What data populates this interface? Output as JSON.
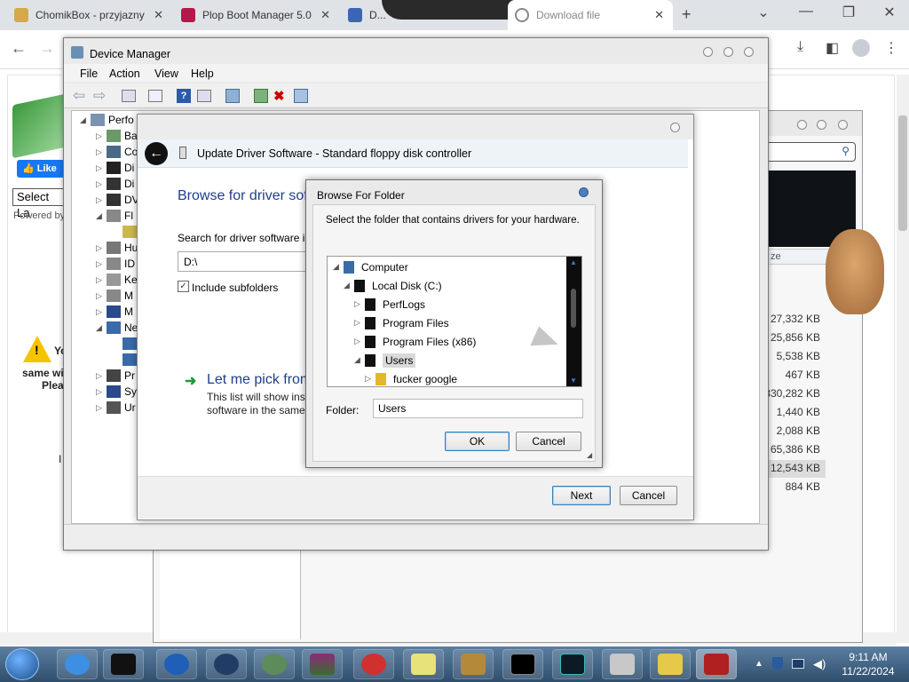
{
  "browser": {
    "tabs": [
      {
        "label": "ChomikBox - przyjazny"
      },
      {
        "label": "Plop Boot Manager 5.0"
      },
      {
        "label": "D..."
      },
      {
        "label": "Download file"
      }
    ],
    "new_tab": "+"
  },
  "webpage": {
    "like_label": "Like",
    "select_label": "Select La",
    "powered_by": "Powered by",
    "warn_text_1": "Yo",
    "warn_text_2": "same wi",
    "warn_text_3": "Plea",
    "letter_l": "I"
  },
  "filewin": {
    "col_header": "ze",
    "sizes": [
      "27,332 KB",
      "25,856 KB",
      "5,538 KB",
      "467 KB",
      "830,282 KB",
      "1,440 KB",
      "2,088 KB",
      "65,386 KB",
      "12,543 KB",
      "884 KB"
    ]
  },
  "devmgr": {
    "title": "Device Manager",
    "menu": [
      "File",
      "Action",
      "View",
      "Help"
    ],
    "tree": {
      "root": "Perfo",
      "items": [
        "Ba",
        "Co",
        "Di",
        "Di",
        "DV",
        "Fl",
        "",
        "Hu",
        "ID",
        "Ke",
        "M",
        "M",
        "Ne",
        "",
        "",
        "Pr",
        "Sy",
        "Ur"
      ]
    }
  },
  "update_driver": {
    "title": "Update Driver Software - Standard floppy disk controller",
    "heading": "Browse for driver sof",
    "search_label": "Search for driver software in",
    "path_value": "D:\\",
    "include_subfolders": "Include subfolders",
    "pick_heading": "Let me pick from",
    "pick_desc_1": "This list will show inst",
    "pick_desc_2": "software in the same",
    "next": "Next",
    "cancel": "Cancel"
  },
  "browse_folder": {
    "title": "Browse For Folder",
    "instruction": "Select the folder that contains drivers for your hardware.",
    "tree": [
      {
        "label": "Computer",
        "level": 0
      },
      {
        "label": "Local Disk (C:)",
        "level": 1
      },
      {
        "label": "PerfLogs",
        "level": 2
      },
      {
        "label": "Program Files",
        "level": 2
      },
      {
        "label": "Program Files (x86)",
        "level": 2
      },
      {
        "label": "Users",
        "level": 2
      },
      {
        "label": "fucker google",
        "level": 3
      }
    ],
    "folder_label": "Folder:",
    "folder_value": "Users",
    "ok": "OK",
    "cancel": "Cancel"
  },
  "taskbar": {
    "time": "9:11 AM",
    "date": "11/22/2024"
  }
}
